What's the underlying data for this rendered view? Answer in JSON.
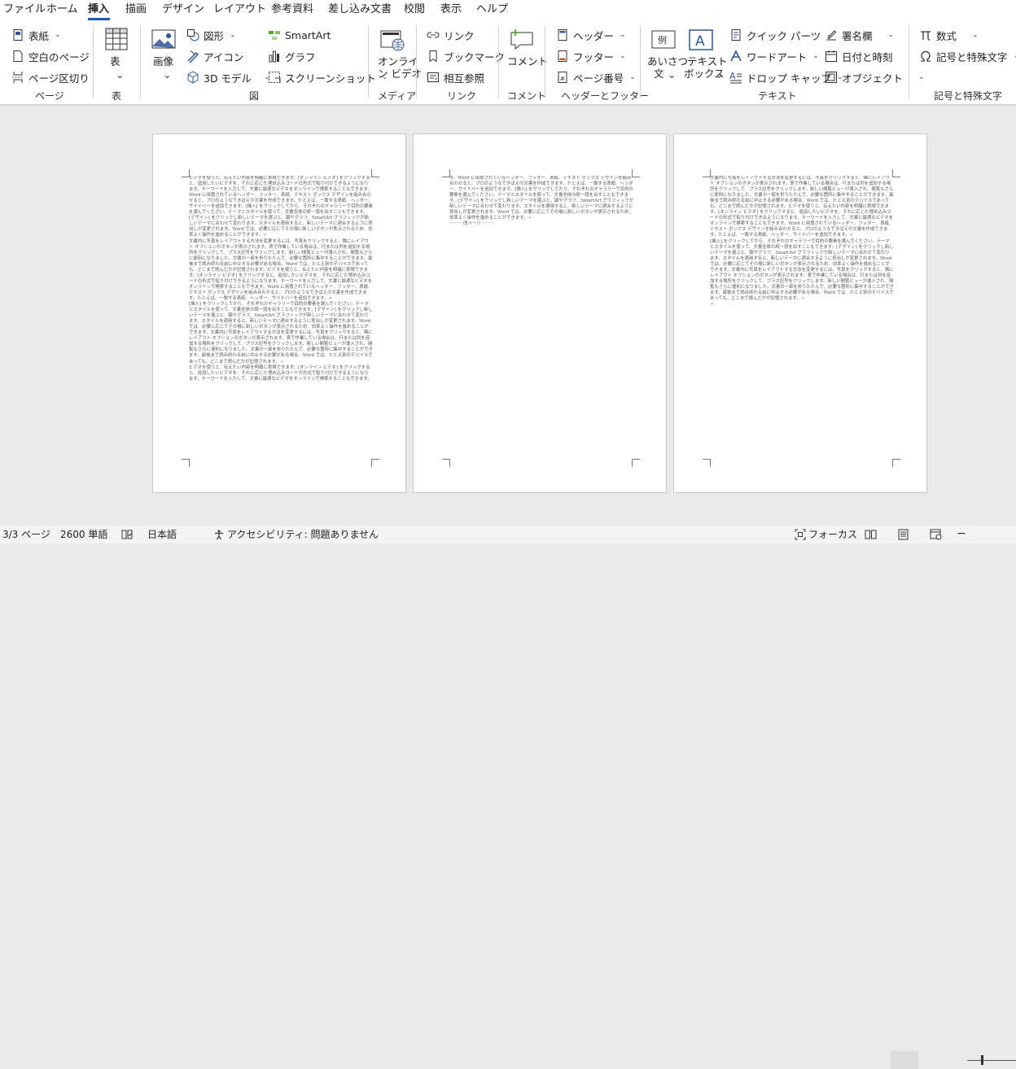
{
  "menu": {
    "tabs": [
      "ファイル",
      "ホーム",
      "挿入",
      "描画",
      "デザイン",
      "レイアウト",
      "参考資料",
      "差し込み文書",
      "校閲",
      "表示",
      "ヘルプ"
    ],
    "active": "挿入"
  },
  "ribbon": {
    "pages": {
      "cover": "表紙",
      "blank": "空白のページ",
      "break": "ページ区切り",
      "group": "ページ"
    },
    "table": {
      "label": "表",
      "group": "表"
    },
    "illustrations": {
      "image": "画像",
      "shapes": "図形",
      "icons": "アイコン",
      "model3d": "3D モデル",
      "smartart": "SmartArt",
      "chart": "グラフ",
      "screenshot": "スクリーンショット",
      "group": "図"
    },
    "media": {
      "video_line1": "オンライ",
      "video_line2": "ン ビデオ",
      "group": "メディア"
    },
    "links": {
      "link": "リンク",
      "bookmark": "ブックマーク",
      "crossref": "相互参照",
      "group": "リンク"
    },
    "comments": {
      "comment": "コメント",
      "group": "コメント"
    },
    "header_footer": {
      "header": "ヘッダー",
      "footer": "フッター",
      "page_number": "ページ番号",
      "group": "ヘッダーとフッター"
    },
    "text": {
      "greeting_line1": "あいさつ",
      "greeting_line2": "文",
      "textbox_line1": "テキスト",
      "textbox_line2": "ボックス",
      "quickparts": "クイック パーツ",
      "wordart": "ワードアート",
      "dropcap": "ドロップ キャップ",
      "signature": "署名欄",
      "datetime": "日付と時刻",
      "object": "オブジェクト",
      "group": "テキスト"
    },
    "symbols": {
      "equation": "数式",
      "symbol": "記号と特殊文字",
      "group": "記号と特殊文字"
    }
  },
  "document": {
    "pages": [
      {
        "paragraphs": [
          "ビデオを使うと、伝えたい内容を明確に表現できます。[オンライン ビデオ] をクリックすると、追加したいビデオを、それに応じた埋め込みコードの形式で貼り付けできるようになります。キーワードを入力して、文書に最適なビデオをオンラインで検索することもできます。Word に用意されているヘッダー、フッター、表紙、テキスト ボックス デザインを組み合わせると、プロのようなできばえの文書を作成できます。たとえば、一致する表紙、ヘッダー、サイドバーを追加できます。[挿入] をクリックしてから、それぞれのギャラリーで目的の要素を選んでください。テーマとスタイルを使って、文書全体の統一感を出すこともできます。[デザイン] をクリックし新しいテーマを選ぶと、図やグラフ、SmartArt グラフィックが新しいテーマに合わせて変わります。スタイルを適用すると、新しいテーマに適合するように見出しが変更されます。Word では、必要に応じてその場に新しいボタンが表示されるため、効率よく操作を進めることができます。↵",
          "文書内に写真をレイアウトする方法を変更するには、写真をクリックすると、隣にレイアウト オプションのボタンが表示されます。表で作業している場合は、行または列を追加する場所をクリックして、プラス記号をクリックします。新しい閲覧ビューが導入され、閲覧もさらに便利になりました。文書の一部を折りたたんで、必要な箇所に集中することができます。最後まで読み終わる前に中止する必要がある場合、Word では、たとえ別のデバイスであっても、どこまで読んだかが記憶されます。ビデオを使うと、伝えたい内容を明確に表現できます。[オンライン ビデオ] をクリックすると、追加したいビデオを、それに応じた埋め込みコードの形式で貼り付けできるようになります。キーワードを入力して、文書に最適なビデオをオンラインで検索することもできます。Word に用意されているヘッダー、フッター、表紙、テキスト ボックス デザインを組み合わせると、プロのようなできばえの文書を作成できます。たとえば、一致する表紙、ヘッダー、サイドバーを追加できます。↵",
          "[挿入] をクリックしてから、それぞれのギャラリーで目的の要素を選んでください。テーマとスタイルを使って、文書全体の統一感を出すこともできます。[デザイン] をクリックし新しいテーマを選ぶと、図やグラフ、SmartArt グラフィックが新しいテーマに合わせて変わります。スタイルを適用すると、新しいテーマに適合するように見出しが変更されます。Word では、必要に応じてその場に新しいボタンが表示されるため、効率よく操作を進めることができます。文書内に写真をレイアウトする方法を変更するには、写真をクリックすると、隣にレイアウト オプションのボタンが表示されます。表で作業している場合は、行または列を追加する場所をクリックして、プラス記号をクリックします。新しい閲覧ビューが導入され、閲覧もさらに便利になりました。文書の一部を折りたたんで、必要な箇所に集中することができます。最後まで読み終わる前に中止する必要がある場合、Word では、たとえ別のデバイスであっても、どこまで読んだかが記憶されます。↵",
          "ビデオを使うと、伝えたい内容を明確に表現できます。[オンライン ビデオ] をクリックすると、追加したいビデオを、それに応じた埋め込みコードの形式で貼り付けできるようになります。キーワードを入力して、文書に最適なビデオをオンラインで検索することもできます。"
        ]
      },
      {
        "paragraphs": [
          "す。Word に用意されているヘッダー、フッター、表紙、テキスト ボックス デザインを組み合わせると、プロのようなできばえの文書を作成できます。たとえば、一致する表紙、ヘッダー、サイドバーを追加できます。[挿入] をクリックしてから、それぞれのギャラリーで目的の要素を選んでください。テーマとスタイルを使って、文書全体の統一感を出すこともできます。[デザイン] をクリックし新しいテーマを選ぶと、図やグラフ、SmartArt グラフィックが新しいテーマに合わせて変わります。スタイルを適用すると、新しいテーマに適合するように見出しが変更されます。Word では、必要に応じてその場に新しいボタンが表示されるため、効率よく操作を進めることができます。↵"
        ],
        "page_break": "改ページ"
      },
      {
        "paragraphs": [
          "文書内に写真をレイアウトする方法を変更するには、写真をクリックすると、隣にレイアウト オプションのボタンが表示されます。表で作業している場合は、行または列を追加する場所をクリックして、プラス記号をクリックします。新しい閲覧ビューが導入され、閲覧もさらに便利になりました。文書の一部を折りたたんで、必要な箇所に集中することができます。最後まで読み終わる前に中止する必要がある場合、Word では、たとえ別のデバイスであっても、どこまで読んだかが記憶されます。ビデオを使うと、伝えたい内容を明確に表現できます。[オンライン ビデオ] をクリックすると、追加したいビデオを、それに応じた埋め込みコードの形式で貼り付けできるようになります。キーワードを入力して、文書に最適なビデオをオンラインで検索することもできます。Word に用意されているヘッダー、フッター、表紙、テキスト ボックス デザインを組み合わせると、プロのようなできばえの文書を作成できます。たとえば、一致する表紙、ヘッダー、サイドバーを追加できます。↵",
          "[挿入] をクリックしてから、それぞれのギャラリーで目的の要素を選んでください。テーマとスタイルを使って、文書全体の統一感を出すこともできます。[デザイン] をクリックし新しいテーマを選ぶと、図やグラフ、SmartArt グラフィックが新しいテーマに合わせて変わります。スタイルを適用すると、新しいテーマに適合するように見出しが変更されます。Word では、必要に応じてその場に新しいボタンが表示されるため、効率よく操作を進めることができます。文書内に写真をレイアウトする方法を変更するには、写真をクリックすると、隣にレイアウト オプションのボタンが表示されます。表で作業している場合は、行または列を追加する場所をクリックして、プラス記号をクリックします。新しい閲覧ビューが導入され、閲覧もさらに便利になりました。文書の一部を折りたたんで、必要な箇所に集中することができます。最後まで読み終わる前に中止する必要がある場合、Word では、たとえ別のデバイスであっても、どこまで読んだかが記憶されます。↵",
          "↵"
        ]
      }
    ]
  },
  "status": {
    "page": "3/3 ページ",
    "words": "2600 単語",
    "language": "日本語",
    "accessibility": "アクセシビリティ: 問題ありません",
    "focus": "フォーカス"
  },
  "colors": {
    "accent": "#185abd",
    "icon_blue": "#2b579a"
  }
}
